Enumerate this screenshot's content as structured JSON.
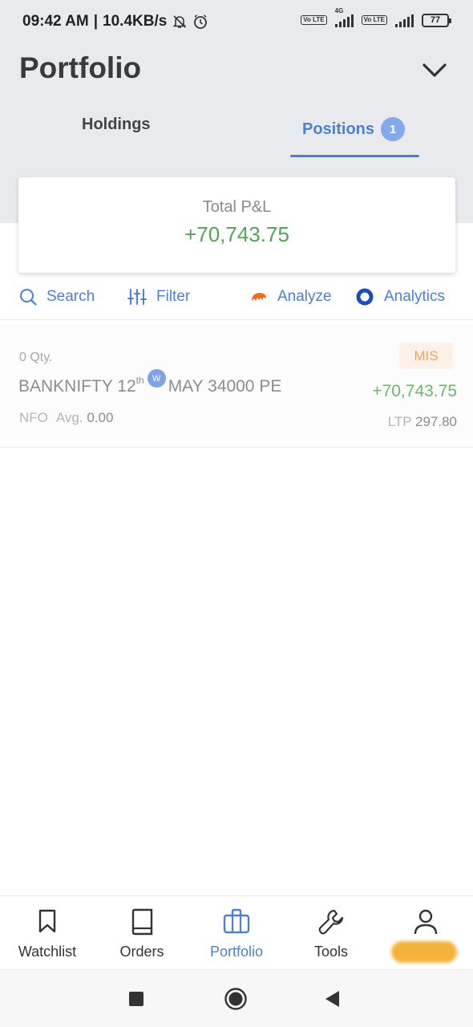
{
  "status_bar": {
    "time": "09:42 AM",
    "speed": "10.4KB/s",
    "network_badge_1": "Vo LTE",
    "network_type": "4G",
    "network_badge_2": "Vo LTE",
    "battery": "77"
  },
  "header": {
    "title": "Portfolio",
    "icon": "chevron-down-icon"
  },
  "tabs": [
    {
      "label": "Holdings",
      "active": false
    },
    {
      "label": "Positions",
      "active": true,
      "badge": "1"
    }
  ],
  "summary": {
    "label": "Total P&L",
    "value": "+70,743.75",
    "value_color": "#56a35a"
  },
  "actions": [
    {
      "label": "Search",
      "icon": "search-icon"
    },
    {
      "label": "Filter",
      "icon": "filter-icon"
    },
    {
      "label": "Analyze",
      "icon": "analyze-icon"
    },
    {
      "label": "Analytics",
      "icon": "analytics-icon"
    }
  ],
  "positions": [
    {
      "qty": "0 Qty.",
      "symbol_pre": "BANKNIFTY 12",
      "symbol_sup": "th",
      "weekly_badge": "W",
      "symbol_post": "MAY 34000 PE",
      "exchange": "NFO",
      "avg_label": "Avg.",
      "avg_value": "0.00",
      "product": "MIS",
      "pnl": "+70,743.75",
      "ltp_label": "LTP",
      "ltp_value": "297.80"
    }
  ],
  "bottom_nav": [
    {
      "label": "Watchlist",
      "icon": "bookmark-icon",
      "active": false
    },
    {
      "label": "Orders",
      "icon": "book-icon",
      "active": false
    },
    {
      "label": "Portfolio",
      "icon": "briefcase-icon",
      "active": true
    },
    {
      "label": "Tools",
      "icon": "wrench-icon",
      "active": false
    },
    {
      "label": "",
      "icon": "user-icon",
      "active": false
    }
  ],
  "colors": {
    "accent": "#4a80d8",
    "profit": "#56a35a",
    "mis_badge": "#f0a070"
  }
}
